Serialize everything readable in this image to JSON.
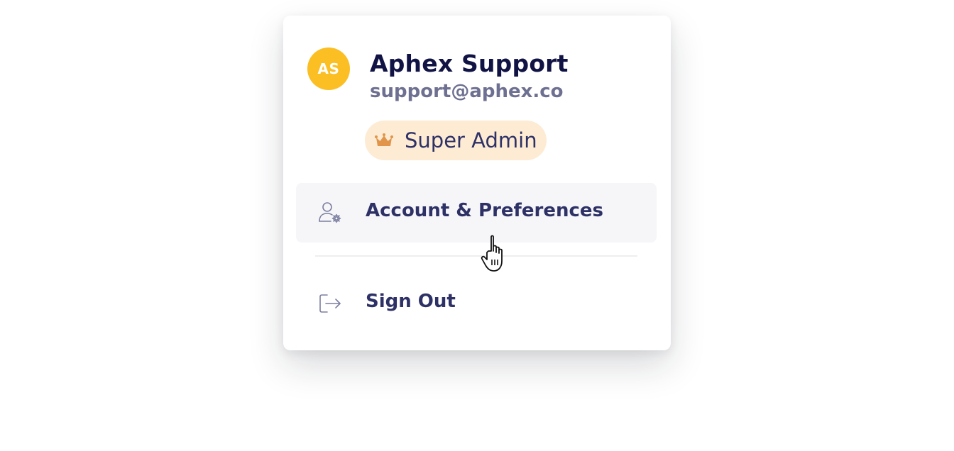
{
  "user": {
    "initials": "AS",
    "name": "Aphex Support",
    "email": "support@aphex.co",
    "avatar_color": "#fbbf24"
  },
  "role_badge": {
    "label": "Super Admin",
    "icon": "crown-icon",
    "background": "#fdebd4",
    "icon_color": "#e0954a"
  },
  "menu": {
    "items": [
      {
        "label": "Account & Preferences",
        "icon": "user-settings-icon",
        "hovered": true
      },
      {
        "label": "Sign Out",
        "icon": "sign-out-icon",
        "hovered": false
      }
    ]
  },
  "colors": {
    "text_primary": "#111344",
    "text_secondary": "#6e7091",
    "menu_text": "#2e3166",
    "hover_bg": "#f6f6f9"
  }
}
